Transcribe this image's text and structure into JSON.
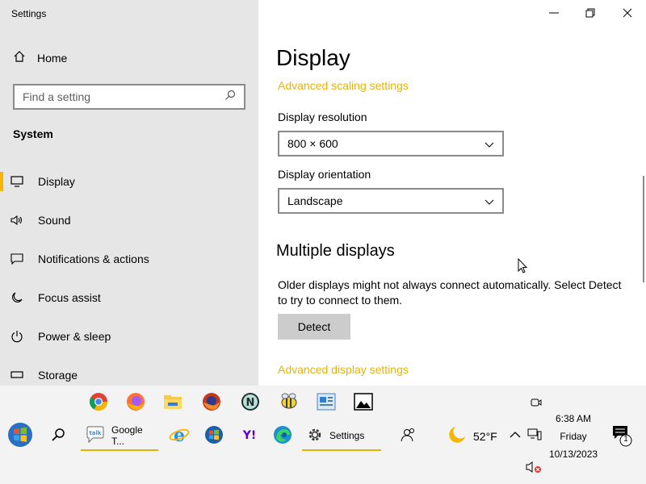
{
  "window": {
    "title": "Settings"
  },
  "sidebar": {
    "home_label": "Home",
    "search_placeholder": "Find a setting",
    "section_title": "System",
    "items": [
      {
        "label": "Display",
        "icon": "monitor-icon",
        "active": true
      },
      {
        "label": "Sound",
        "icon": "speaker-icon"
      },
      {
        "label": "Notifications & actions",
        "icon": "message-icon"
      },
      {
        "label": "Focus assist",
        "icon": "moon-icon"
      },
      {
        "label": "Power & sleep",
        "icon": "power-icon"
      },
      {
        "label": "Storage",
        "icon": "drive-icon"
      }
    ]
  },
  "main": {
    "title": "Display",
    "advanced_scaling_link": "Advanced scaling settings",
    "resolution_label": "Display resolution",
    "resolution_value": "800 × 600",
    "orientation_label": "Display orientation",
    "orientation_value": "Landscape",
    "multiple_displays_title": "Multiple displays",
    "multiple_displays_text": "Older displays might not always connect automatically. Select Detect to try to connect to them.",
    "detect_button": "Detect",
    "advanced_display_link": "Advanced display settings"
  },
  "taskbar": {
    "pinned_top": [
      "chrome-icon",
      "firefox-icon",
      "folder-icon",
      "firefox-dark-icon",
      "n-icon",
      "bee-icon",
      "image-app-icon",
      "photo-icon"
    ],
    "apps": [
      {
        "label": "Google T...",
        "icon": "talk-icon"
      },
      {
        "label": "Settings",
        "icon": "gear-icon"
      }
    ],
    "weather": "52°F",
    "time": "6:38 AM",
    "day": "Friday",
    "date": "10/13/2023",
    "notification_count": "1",
    "accent": "#e8b300"
  }
}
